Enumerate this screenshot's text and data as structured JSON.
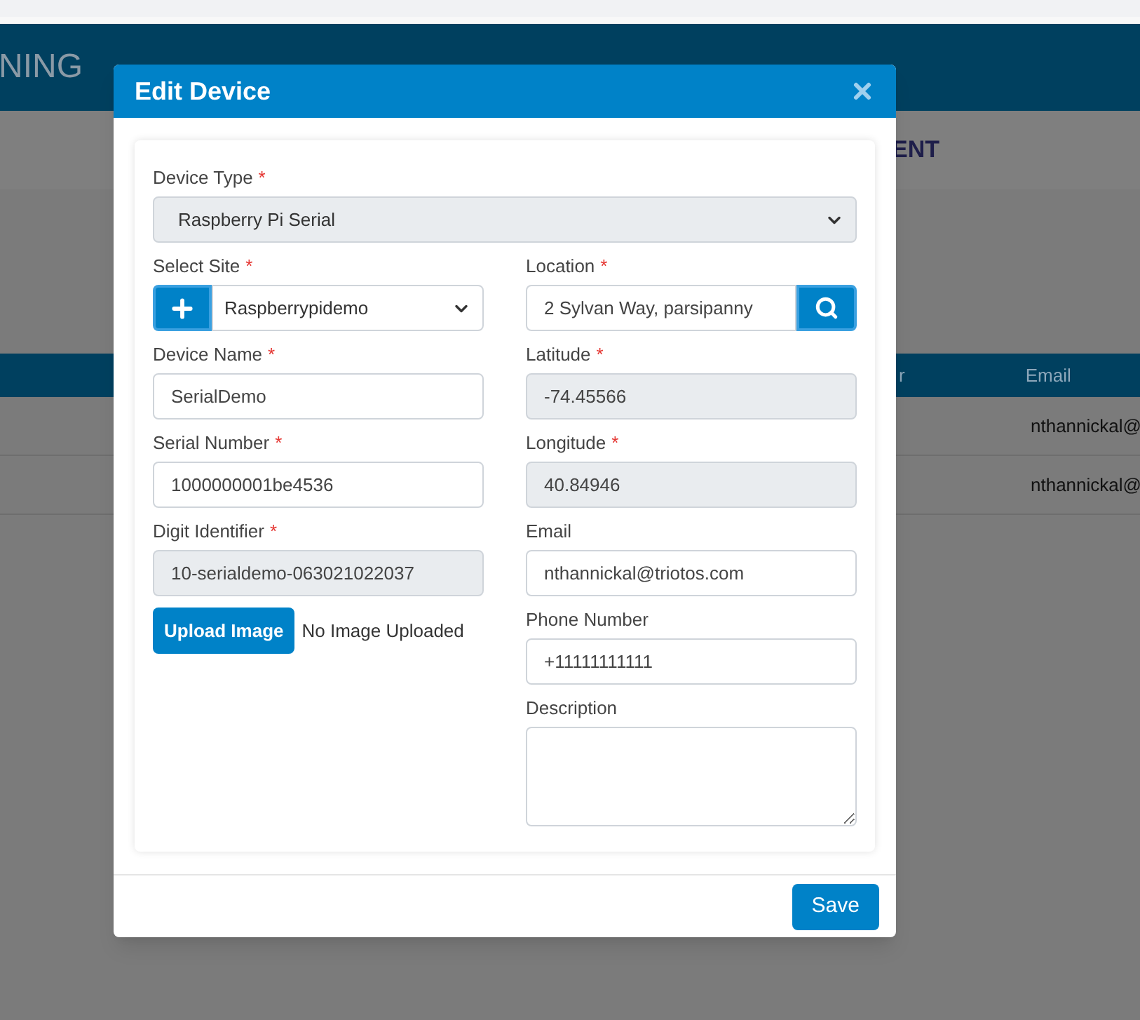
{
  "background": {
    "header_title": "NING",
    "nav_label": "ENT",
    "table": {
      "columns": [
        "r",
        "Email"
      ],
      "rows": [
        [
          "nthannickal@"
        ],
        [
          "nthannickal@"
        ]
      ]
    }
  },
  "modal": {
    "title": "Edit Device",
    "required_marker": "*",
    "device_type": {
      "label": "Device Type",
      "required": true,
      "value": "Raspberry Pi Serial"
    },
    "left_fields": [
      {
        "kind": "site",
        "label": "Select Site",
        "required": true,
        "value": "Raspberrypidemo"
      },
      {
        "kind": "text",
        "label": "Device Name",
        "required": true,
        "value": "SerialDemo"
      },
      {
        "kind": "text",
        "label": "Serial Number",
        "required": true,
        "value": "1000000001be4536"
      },
      {
        "kind": "readonly",
        "label": "Digit Identifier",
        "required": true,
        "value": "10-serialdemo-063021022037"
      }
    ],
    "upload": {
      "button": "Upload Image",
      "status": "No Image Uploaded"
    },
    "right_fields": [
      {
        "kind": "location",
        "label": "Location",
        "required": true,
        "value": "2 Sylvan Way, parsipanny"
      },
      {
        "kind": "readonly",
        "label": "Latitude",
        "required": true,
        "value": "-74.45566"
      },
      {
        "kind": "readonly",
        "label": "Longitude",
        "required": true,
        "value": "40.84946"
      },
      {
        "kind": "text",
        "label": "Email",
        "required": false,
        "value": "nthannickal@triotos.com"
      },
      {
        "kind": "text",
        "label": "Phone Number",
        "required": false,
        "value": "+11111111111"
      },
      {
        "kind": "textarea",
        "label": "Description",
        "required": false
      }
    ],
    "save": "Save"
  }
}
